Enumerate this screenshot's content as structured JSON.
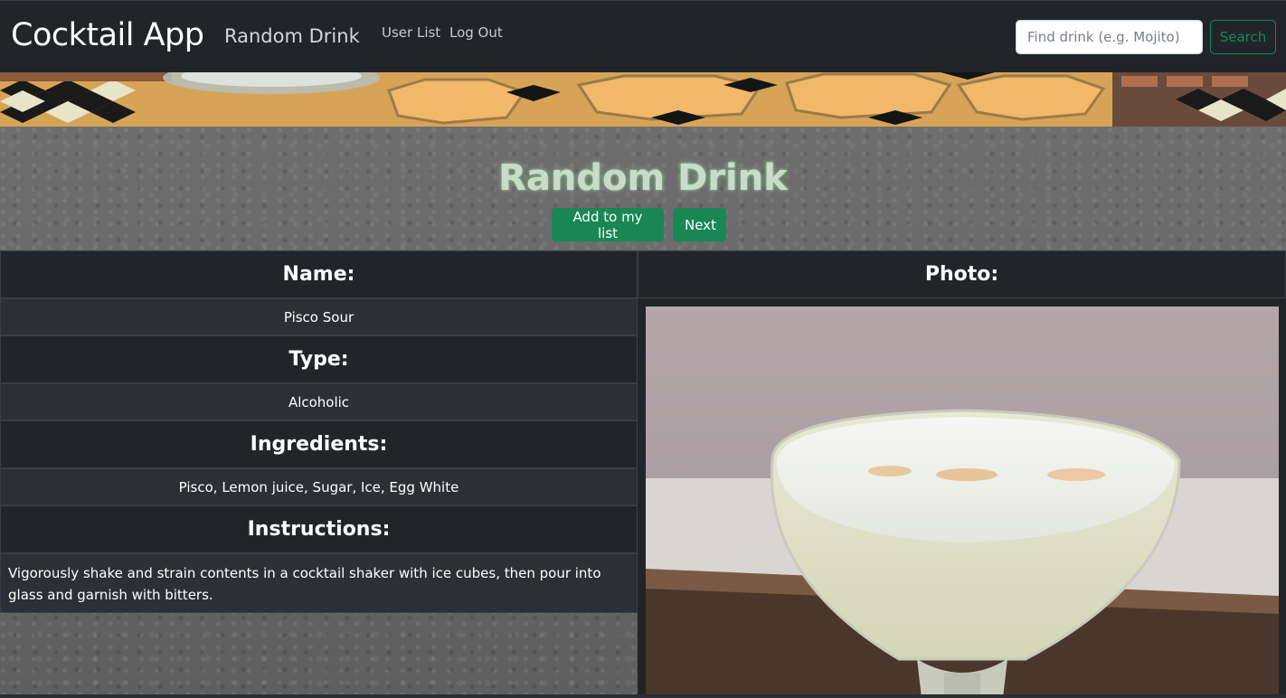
{
  "navbar": {
    "brand": "Cocktail App",
    "random_drink": "Random Drink",
    "links": [
      "User List",
      "Log Out"
    ],
    "search_placeholder": "Find drink (e.g. Mojito)",
    "search_button": "Search"
  },
  "page": {
    "title": "Random Drink",
    "add_button": "Add to my list",
    "next_button": "Next"
  },
  "drink": {
    "name_label": "Name:",
    "name": "Pisco Sour",
    "type_label": "Type:",
    "type": "Alcoholic",
    "ingredients_label": "Ingredients:",
    "ingredients": "Pisco, Lemon juice, Sugar, Ice, Egg White",
    "instructions_label": "Instructions:",
    "instructions": "Vigorously shake and strain contents in a cocktail shaker with ice cubes, then pour into glass and garnish with bitters.",
    "photo_label": "Photo:"
  },
  "colors": {
    "navbar_bg": "#212529",
    "accent_green": "#198754",
    "table_bg": "#2c3034"
  }
}
